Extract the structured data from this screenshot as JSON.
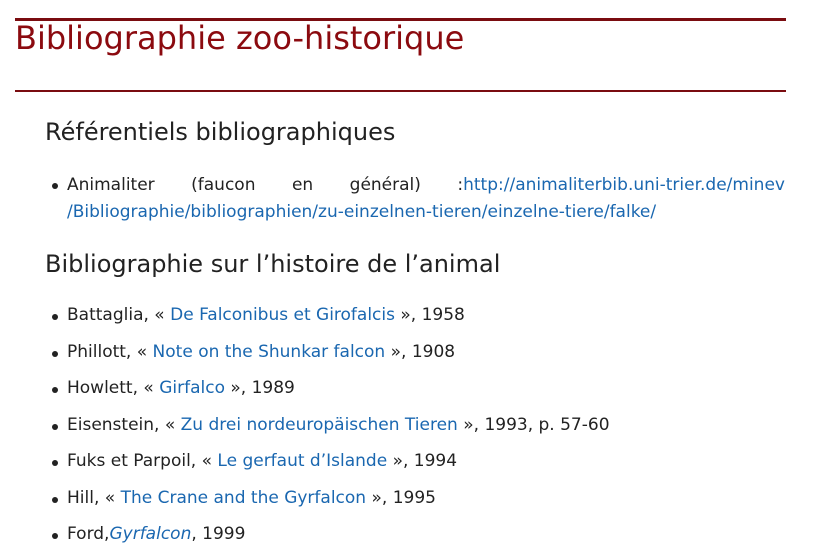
{
  "page": {
    "title": "Bibliographie zoo-historique"
  },
  "sections": {
    "referentiels": {
      "heading": "Référentiels bibliographiques",
      "item": {
        "words": [
          "Animaliter",
          "(faucon",
          "en",
          "général)"
        ],
        "separator": ":",
        "url_part1": "http://animaliterbib.uni-trier.de/minev",
        "url_part2": "/Bibliographie/bibliographien/zu-einzelnen-tieren/einzelne-tiere/falke/"
      }
    },
    "histoire": {
      "heading": "Bibliographie sur l’histoire de l’animal",
      "items": [
        {
          "author": "Battaglia, « ",
          "title": "De Falconibus et Girofalcis",
          "tail": " », 1958"
        },
        {
          "author": "Phillott, « ",
          "title": "Note on the Shunkar falcon",
          "tail": " », 1908"
        },
        {
          "author": "Howlett, « ",
          "title": "Girfalco",
          "tail": " », 1989"
        },
        {
          "author": "Eisenstein, « ",
          "title": "Zu drei nordeuropäischen Tieren",
          "tail": " », 1993, p. 57-60"
        },
        {
          "author": "Fuks et Parpoil, « ",
          "title": "Le gerfaut d’Islande",
          "tail": " », 1994"
        },
        {
          "author": "Hill, « ",
          "title": "The Crane and the Gyrfalcon",
          "tail": " », 1995"
        },
        {
          "author": "Ford,",
          "title": "Gyrfalcon",
          "tail": ", 1999"
        }
      ]
    }
  },
  "colors": {
    "title": "#8b0a0f",
    "rule": "#7a0c10",
    "link": "#1a67b0",
    "text": "#222222"
  }
}
